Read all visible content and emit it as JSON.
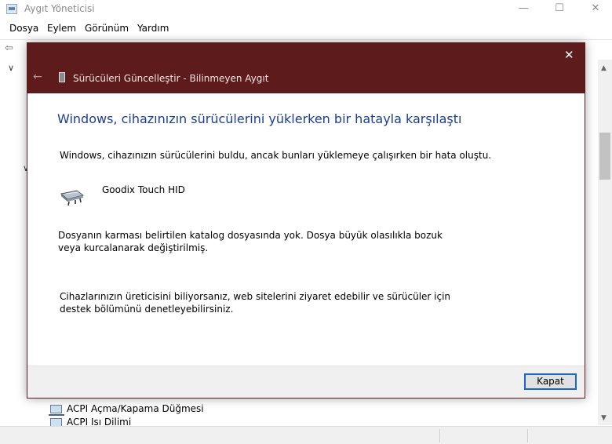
{
  "background_window": {
    "title": "Aygıt Yöneticisi",
    "controls": {
      "minimize": "—",
      "maximize": "☐",
      "close": "✕"
    },
    "menu": [
      "Dosya",
      "Eylem",
      "Görünüm",
      "Yardım"
    ],
    "tree_items": [
      {
        "label": "ACPI Açma/Kapama Düğmesi",
        "icon": "computer-icon"
      },
      {
        "label": "ACPI Isı Dilimi",
        "icon": "computer-icon"
      }
    ]
  },
  "dialog": {
    "title": "Sürücüleri Güncelleştir - Bilinmeyen Aygıt",
    "back_glyph": "←",
    "close_glyph": "✕",
    "heading": "Windows, cihazınızın sürücülerini yüklerken bir hatayla karşılaştı",
    "found_text": "Windows, cihazınızın sürücülerini buldu, ancak bunları yüklemeye çalışırken bir hata oluştu.",
    "driver_name": "Goodix Touch HID",
    "driver_icon": "touchpad-device-icon",
    "error_text": "Dosyanın karması belirtilen katalog dosyasında yok. Dosya büyük olasılıkla bozuk veya kurcalanarak değiştirilmiş.",
    "help_text": "Cihazlarınızın üreticisini biliyorsanız, web sitelerini ziyaret edebilir ve sürücüler için destek bölümünü denetleyebilirsiniz.",
    "close_button_label": "Kapat"
  },
  "colors": {
    "dialog_titlebar": "#5d1b1b",
    "heading": "#1a3d96",
    "button_focus_border": "#1c66c8"
  }
}
